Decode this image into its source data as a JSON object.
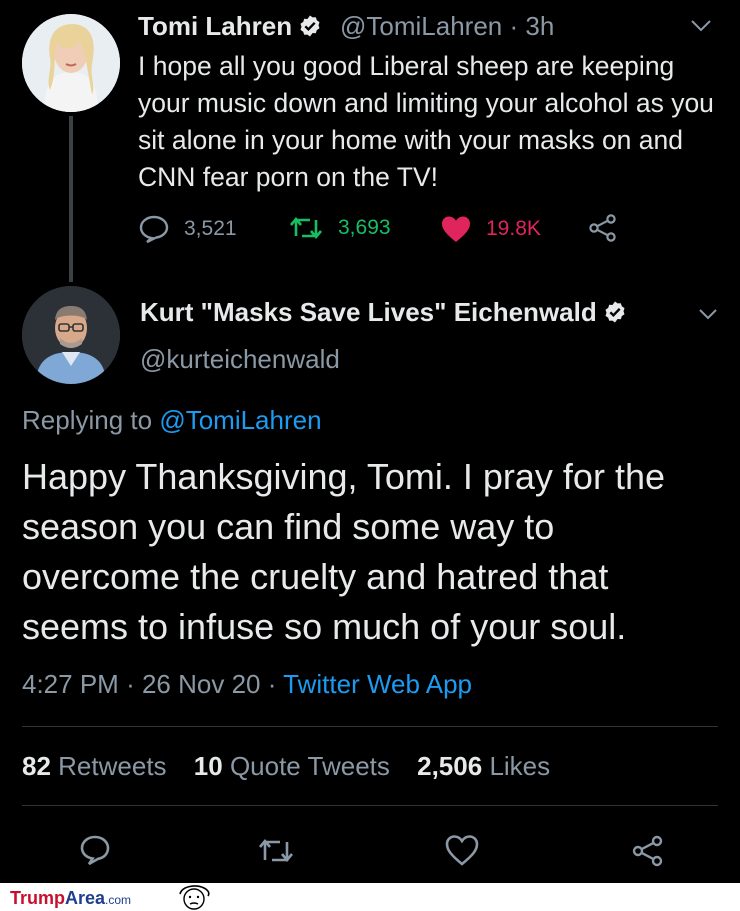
{
  "parent_tweet": {
    "name": "Tomi Lahren",
    "handle": "@TomiLahren",
    "time": "· 3h",
    "text": "I hope all you good Liberal sheep are keeping your music down and limiting your alcohol as you sit alone in your home with your masks on and CNN fear porn on the TV!",
    "replies": "3,521",
    "retweets": "3,693",
    "likes": "19.8K"
  },
  "reply_tweet": {
    "name": "Kurt \"Masks Save Lives\" Eichenwald",
    "handle": "@kurteichenwald",
    "replying_to_prefix": "Replying to",
    "replying_to_handle": "@TomiLahren",
    "text": "Happy Thanksgiving, Tomi. I pray for the season you can find some way to overcome the cruelty and hatred that seems to infuse so much of your soul.",
    "time": "4:27 PM",
    "date": "26 Nov 20",
    "source": "Twitter Web App",
    "retweets_count": "82",
    "retweets_label": "Retweets",
    "quotes_count": "10",
    "quotes_label": "Quote Tweets",
    "likes_count": "2,506",
    "likes_label": "Likes"
  },
  "colors": {
    "background": "#000000",
    "link": "#1d9bf0",
    "retweet_green": "#17bf63",
    "like_pink": "#e0245e",
    "muted": "#8b98a5"
  },
  "watermark": {
    "part1": "Trump",
    "part2": "Area",
    "part3": ".com"
  }
}
